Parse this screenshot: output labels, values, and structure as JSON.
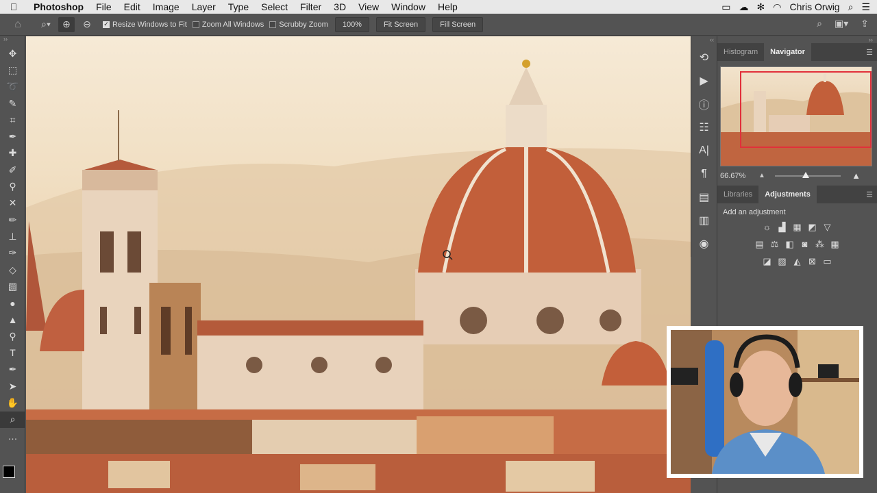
{
  "menubar": {
    "app_name": "Photoshop",
    "items": [
      "File",
      "Edit",
      "Image",
      "Layer",
      "Type",
      "Select",
      "Filter",
      "3D",
      "View",
      "Window",
      "Help"
    ],
    "user": "Chris Orwig"
  },
  "options": {
    "resize_windows": "Resize Windows to Fit",
    "zoom_all": "Zoom All Windows",
    "scrubby": "Scrubby Zoom",
    "zoom_value": "100%",
    "fit_screen": "Fit Screen",
    "fill_screen": "Fill Screen"
  },
  "panels": {
    "top_tabs": [
      "Histogram",
      "Navigator"
    ],
    "zoom_percent": "66.67%",
    "bottom_tabs": [
      "Libraries",
      "Adjustments"
    ],
    "adjustment_heading": "Add an adjustment"
  },
  "colors": {
    "menubar_bg": "#e8e8e8",
    "ui_bg": "#535353",
    "accent_red": "#e1303a"
  }
}
